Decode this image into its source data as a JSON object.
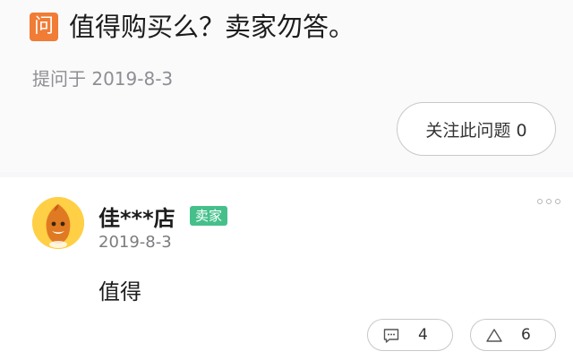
{
  "question": {
    "icon_char": "问",
    "title": "值得购买么？卖家勿答。",
    "meta": "提问于 2019-8-3",
    "follow_label": "关注此问题 0"
  },
  "answer": {
    "user_name": "佳***店",
    "badge": "卖家",
    "date": "2019-8-3",
    "text": "值得",
    "comment_count": "4",
    "like_count": "6"
  },
  "colors": {
    "question_icon": "#f07c36",
    "seller_badge": "#45c08b",
    "avatar": "#ffc93c"
  },
  "icons": {
    "question": "question-icon",
    "more": "more-dots-icon",
    "comment": "comment-icon",
    "like": "triangle-up-icon"
  }
}
